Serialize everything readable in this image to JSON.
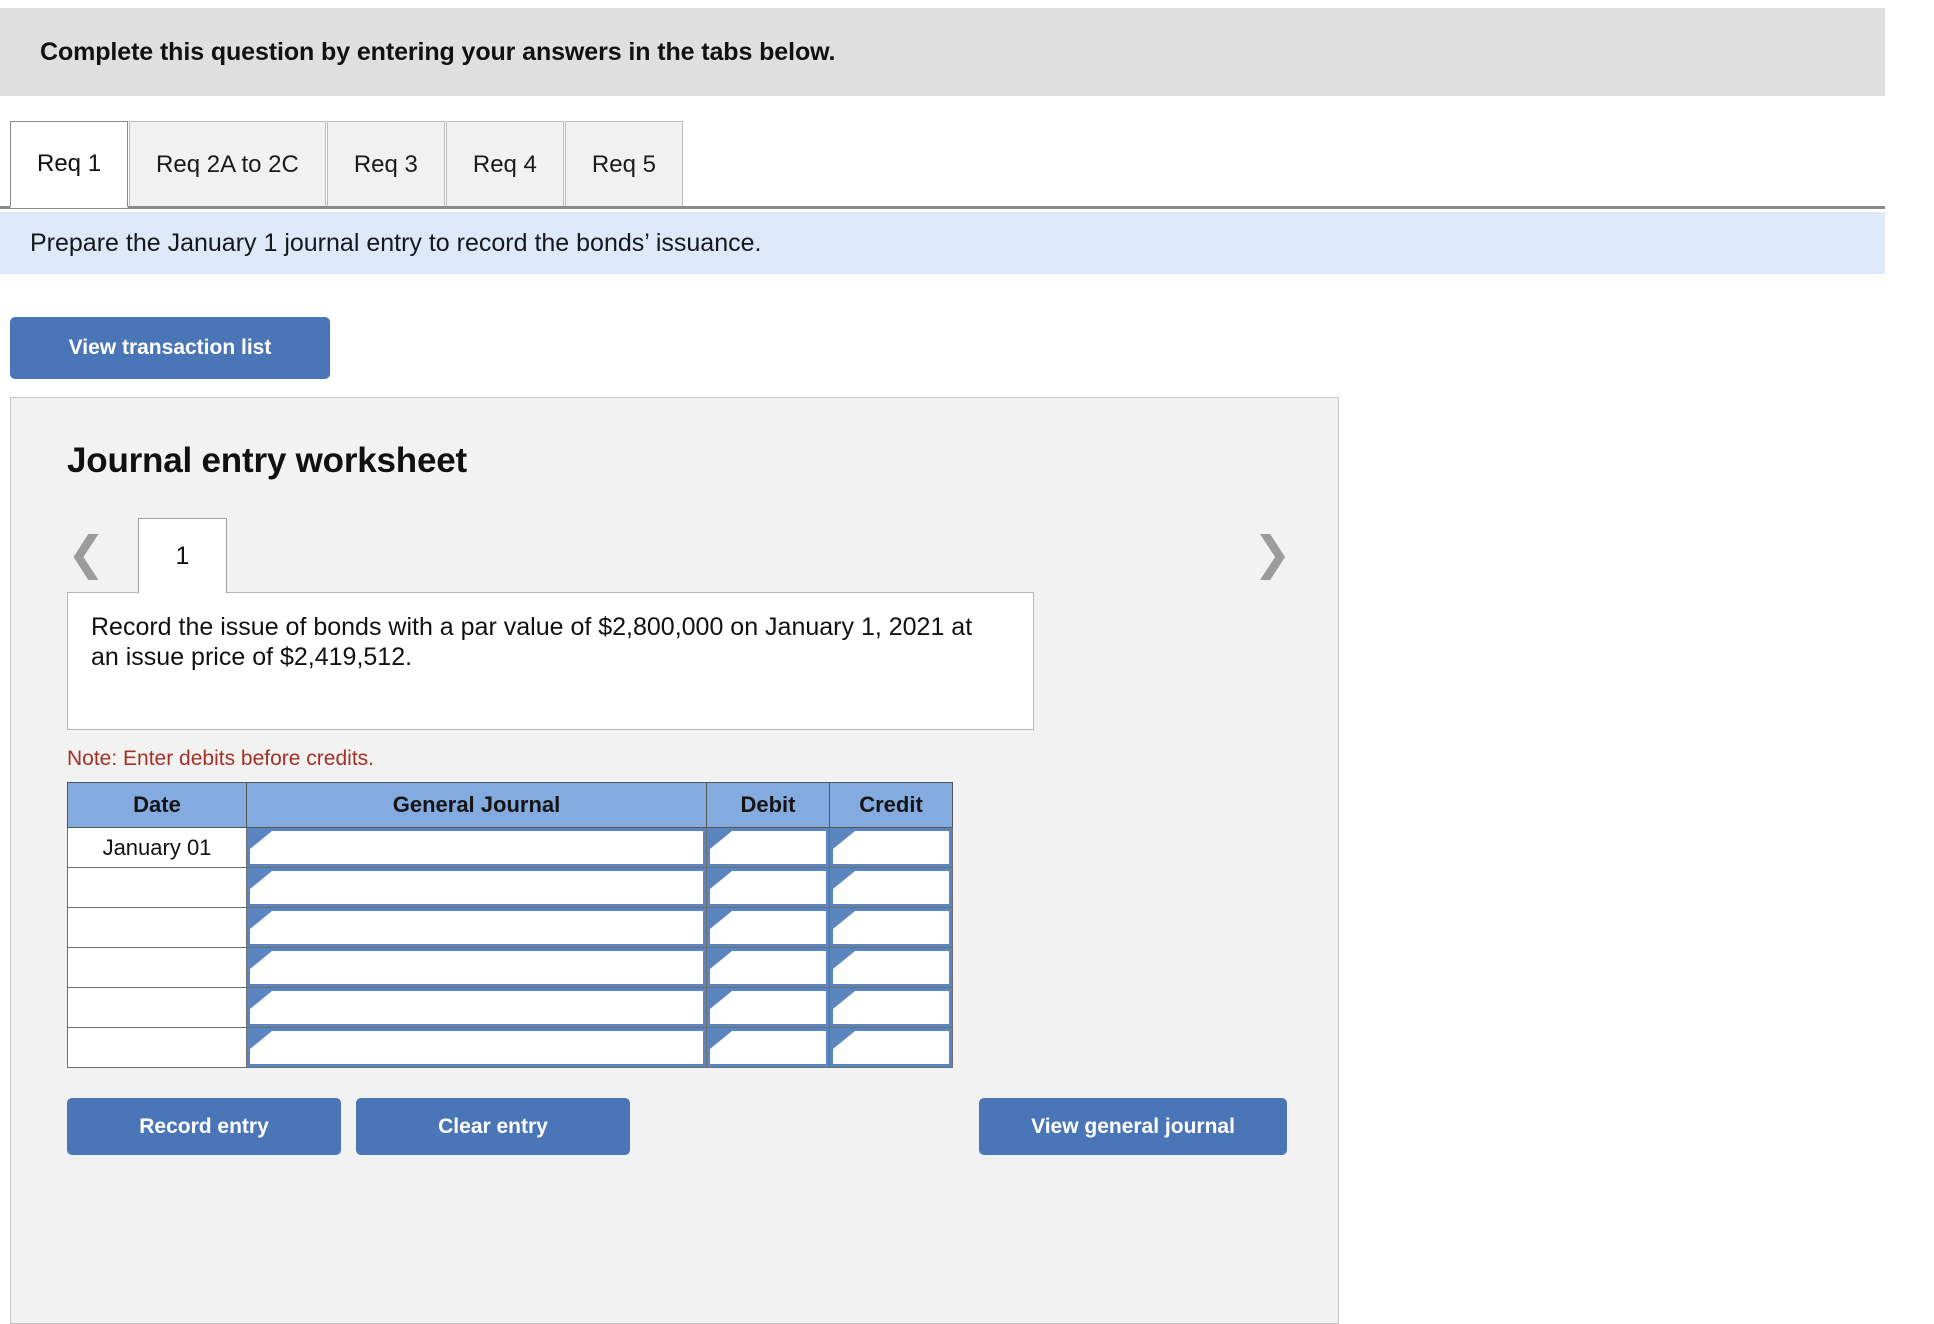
{
  "banner": {
    "instruction": "Complete this question by entering your answers in the tabs below."
  },
  "tabs": [
    {
      "label": "Req 1",
      "active": true
    },
    {
      "label": "Req 2A to 2C",
      "active": false
    },
    {
      "label": "Req 3",
      "active": false
    },
    {
      "label": "Req 4",
      "active": false
    },
    {
      "label": "Req 5",
      "active": false
    }
  ],
  "requirement": {
    "text": "Prepare the January 1 journal entry to record the bonds’ issuance."
  },
  "toolbar": {
    "view_transaction_list_label": "View transaction list"
  },
  "worksheet": {
    "title": "Journal entry worksheet",
    "prev_icon": "chevron-left-icon",
    "next_icon": "chevron-right-icon",
    "page_tabs": [
      {
        "label": "1",
        "active": true
      }
    ],
    "transaction_description": "Record the issue of bonds with a par value of $2,800,000 on January 1, 2021 at an issue price of $2,419,512.",
    "note": "Note: Enter debits before credits.",
    "table": {
      "headers": [
        "Date",
        "General Journal",
        "Debit",
        "Credit"
      ],
      "rows": [
        {
          "date": "January 01",
          "general_journal": "",
          "debit": "",
          "credit": ""
        },
        {
          "date": "",
          "general_journal": "",
          "debit": "",
          "credit": ""
        },
        {
          "date": "",
          "general_journal": "",
          "debit": "",
          "credit": ""
        },
        {
          "date": "",
          "general_journal": "",
          "debit": "",
          "credit": ""
        },
        {
          "date": "",
          "general_journal": "",
          "debit": "",
          "credit": ""
        },
        {
          "date": "",
          "general_journal": "",
          "debit": "",
          "credit": ""
        }
      ]
    },
    "buttons": {
      "record_entry": "Record entry",
      "clear_entry": "Clear entry",
      "view_general_journal": "View general journal"
    }
  },
  "colors": {
    "banner_bg": "#dfdfdf",
    "requirement_bg": "#dde9f8",
    "button_blue": "#4a76b8",
    "table_header_blue": "#83abe0",
    "cell_border_blue": "#5a85bf",
    "note_red": "#a33126",
    "panel_bg": "#f2f2f2"
  }
}
